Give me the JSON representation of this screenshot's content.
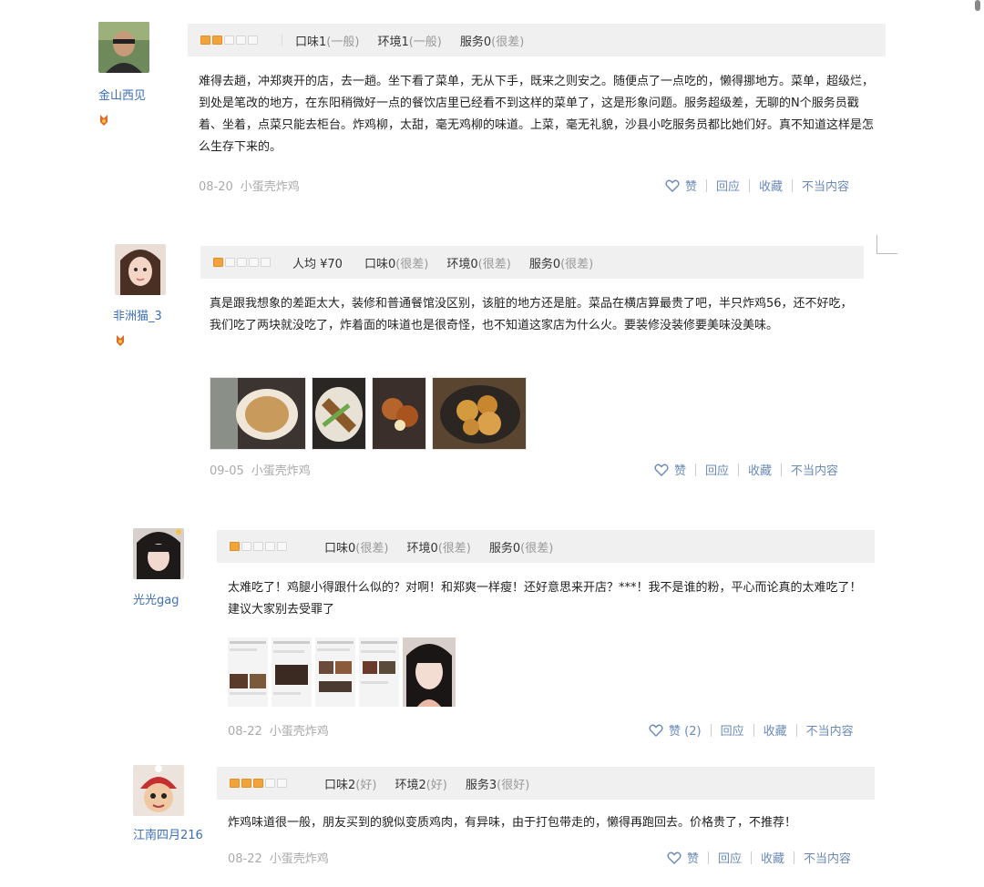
{
  "reviews": [
    {
      "username": "金山西见",
      "stars": 2,
      "price": "",
      "taste": {
        "label": "口味1",
        "level": "(一般)"
      },
      "env": {
        "label": "环境1",
        "level": "(一般)"
      },
      "service": {
        "label": "服务0",
        "level": "(很差)"
      },
      "body": "难得去趟，冲郑爽开的店，去一趟。坐下看了菜单，无从下手，既来之则安之。随便点了一点吃的，懒得挪地方。菜单，超级烂，到处是笔改的地方，在东阳稍微好一点的餐饮店里已经看不到这样的菜单了，这是形象问题。服务超级差，无聊的N个服务员戳着、坐着，点菜只能去柜台。炸鸡柳，太甜，毫无鸡柳的味道。上菜，毫无礼貌，沙县小吃服务员都比她们好。真不知道这样是怎么生存下来的。",
      "date": "08-20",
      "shop": "小蛋壳炸鸡",
      "like": "赞",
      "reply": "回应",
      "fav": "收藏",
      "report": "不当内容"
    },
    {
      "username": "非洲猫_3",
      "stars": 1,
      "price": "人均 ¥70",
      "taste": {
        "label": "口味0",
        "level": "(很差)"
      },
      "env": {
        "label": "环境0",
        "level": "(很差)"
      },
      "service": {
        "label": "服务0",
        "level": "(很差)"
      },
      "body": "真是跟我想象的差距太大，装修和普通餐馆没区别，该脏的地方还是脏。菜品在横店算最贵了吧，半只炸鸡56，还不好吃，我们吃了两块就没吃了，炸着面的味道也是很奇怪，也不知道这家店为什么火。要装修没装修要美味没美味。",
      "date": "09-05",
      "shop": "小蛋壳炸鸡",
      "like": "赞",
      "reply": "回应",
      "fav": "收藏",
      "report": "不当内容"
    },
    {
      "username": "光光gag",
      "stars": 1,
      "price": "",
      "taste": {
        "label": "口味0",
        "level": "(很差)"
      },
      "env": {
        "label": "环境0",
        "level": "(很差)"
      },
      "service": {
        "label": "服务0",
        "level": "(很差)"
      },
      "body": "太难吃了！鸡腿小得跟什么似的？对啊！和郑爽一样瘦！还好意思来开店？***！我不是谁的粉，平心而论真的太难吃了！建议大家别去受罪了",
      "date": "08-22",
      "shop": "小蛋壳炸鸡",
      "like": "赞 (2)",
      "reply": "回应",
      "fav": "收藏",
      "report": "不当内容"
    },
    {
      "username": "江南四月216",
      "stars": 3,
      "price": "",
      "taste": {
        "label": "口味2",
        "level": "(好)"
      },
      "env": {
        "label": "环境2",
        "level": "(好)"
      },
      "service": {
        "label": "服务3",
        "level": "(很好)"
      },
      "body": "炸鸡味道很一般，朋友买到的貌似变质鸡肉，有异味，由于打包带走的，懒得再跑回去。价格贵了，不推荐！",
      "date": "08-22",
      "shop": "小蛋壳炸鸡",
      "like": "赞",
      "reply": "回应",
      "fav": "收藏",
      "report": "不当内容"
    }
  ],
  "colors": {
    "star_on": "#f2a33a",
    "link": "#6a89b8",
    "username": "#3b6fb6",
    "bar_bg": "#f0f0f0"
  }
}
